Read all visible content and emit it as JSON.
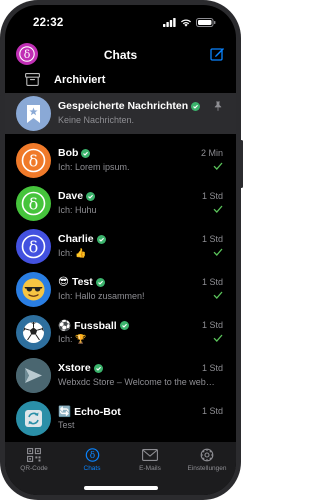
{
  "status_bar": {
    "time": "22:32"
  },
  "header": {
    "title": "Chats"
  },
  "archive": {
    "label": "Archiviert"
  },
  "chats": [
    {
      "name": "Gespeicherte Nachrichten",
      "preview": "Keine Nachrichten.",
      "time": "",
      "pinned": true,
      "avatar_color": "#8aa9d6",
      "avatar_icon": "bookmark-star"
    },
    {
      "name": "Bob",
      "preview": "Ich: Lorem ipsum.",
      "time": "2 Min",
      "avatar_color": "#f07a2a",
      "avatar_icon": "delta"
    },
    {
      "name": "Dave",
      "preview": "Ich: Huhu",
      "time": "1 Std",
      "avatar_color": "#46c43c",
      "avatar_icon": "delta"
    },
    {
      "name": "Charlie",
      "preview": "Ich: 👍",
      "time": "1 Std",
      "avatar_color": "#4351e0",
      "avatar_icon": "delta"
    },
    {
      "name_emoji": "😎",
      "name": "Test",
      "preview": "Ich: Hallo zusammen!",
      "time": "1 Std",
      "avatar_color": "#2a7ee3",
      "avatar_icon": "sunglasses"
    },
    {
      "name_emoji": "⚽",
      "name": "Fussball",
      "preview": "Ich: 🏆",
      "time": "1 Std",
      "avatar_color": "#2e6f9e",
      "avatar_icon": "soccer"
    },
    {
      "name": "Xstore",
      "preview": "Webxdc Store – Welcome to the webxdc store!",
      "time": "1 Std",
      "avatar_color": "#4a6670",
      "avatar_icon": "xstore"
    },
    {
      "name_emoji": "🔄",
      "name": "Echo-Bot",
      "preview": "Test",
      "time": "1 Std",
      "avatar_color": "#2a8fa8",
      "avatar_icon": "echo"
    }
  ],
  "tabs": [
    {
      "label": "QR-Code",
      "icon": "qr-code-icon",
      "active": false
    },
    {
      "label": "Chats",
      "icon": "chats-icon",
      "active": true
    },
    {
      "label": "E-Mails",
      "icon": "mail-icon",
      "active": false
    },
    {
      "label": "Einstellungen",
      "icon": "settings-icon",
      "active": false
    }
  ],
  "colors": {
    "accent": "#0a84ff",
    "verified": "#3bb36c",
    "check": "#5bc35b",
    "background": "#000000"
  }
}
